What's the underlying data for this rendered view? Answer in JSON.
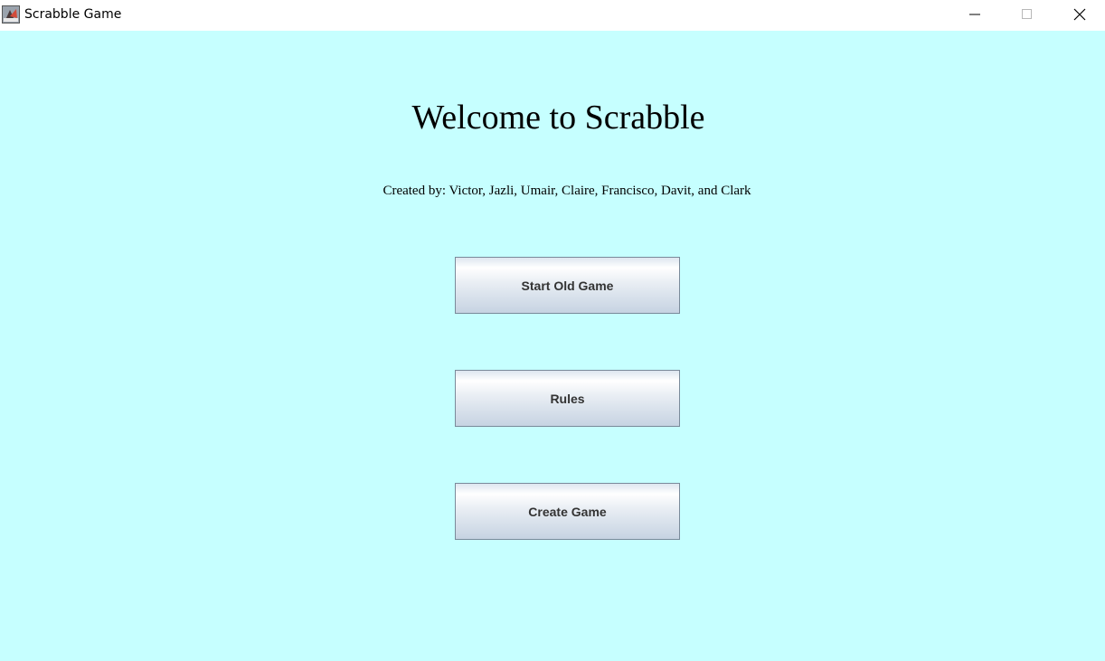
{
  "window": {
    "title": "Scrabble Game",
    "icon": "scrabble-app-icon",
    "controls": [
      "minimize-icon",
      "maximize-icon",
      "close-icon"
    ]
  },
  "main": {
    "heading": "Welcome to Scrabble",
    "credits": "Created by: Victor, Jazli, Umair, Claire, Francisco, Davit, and Clark",
    "buttons": [
      {
        "label": "Start Old Game"
      },
      {
        "label": "Rules"
      },
      {
        "label": "Create Game"
      }
    ]
  },
  "colors": {
    "background": "#c6ffff",
    "titlebar": "#ffffff",
    "button_border": "#7a8a9a",
    "button_text": "#333333"
  }
}
